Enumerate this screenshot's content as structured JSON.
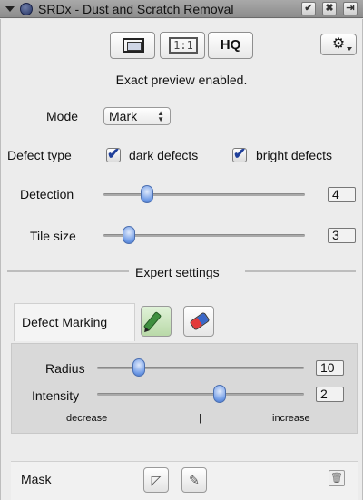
{
  "window": {
    "title": "SRDx - Dust and Scratch Removal",
    "buttons": [
      "✔",
      "✖",
      "⇥"
    ]
  },
  "toolbar": {
    "preview_icon": "preview-frame-icon",
    "one_to_one_label": "1:1",
    "hq_label": "HQ",
    "settings_icon": "gear-icon"
  },
  "status": "Exact preview enabled.",
  "mode": {
    "label": "Mode",
    "value": "Mark"
  },
  "defect_type": {
    "label": "Defect type",
    "dark": {
      "label": "dark defects",
      "checked": true
    },
    "bright": {
      "label": "bright defects",
      "checked": true
    }
  },
  "detection": {
    "label": "Detection",
    "value": "4",
    "position": 0.21
  },
  "tile_size": {
    "label": "Tile size",
    "value": "3",
    "position": 0.12
  },
  "expert_settings": {
    "label": "Expert settings"
  },
  "defect_marking": {
    "label": "Defect Marking",
    "tools": [
      "pen-add-icon",
      "eraser-icon"
    ],
    "radius": {
      "label": "Radius",
      "value": "10",
      "position": 0.2
    },
    "intensity": {
      "label": "Intensity",
      "value": "2",
      "position": 0.59
    },
    "decrease_label": "decrease",
    "center_mark": "|",
    "increase_label": "increase"
  },
  "mask": {
    "label": "Mask",
    "icons": [
      "mask-shape-icon",
      "mask-brush-icon",
      "trash-icon"
    ]
  },
  "colors": {
    "slider_thumb": "#6e9ae6",
    "checkmark": "#1f3f9a",
    "titlebar": "#9a9a9a"
  }
}
